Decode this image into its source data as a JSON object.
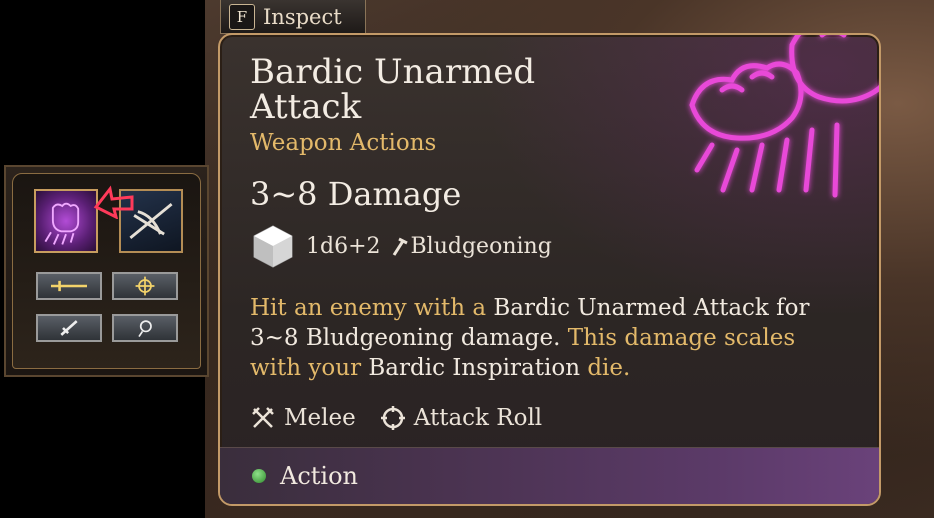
{
  "inspect": {
    "key": "F",
    "label": "Inspect"
  },
  "tooltip": {
    "title": "Bardic Unarmed Attack",
    "subtitle": "Weapon Actions",
    "damage": "3~8 Damage",
    "dice": "1d6+2",
    "damage_type": "Bludgeoning",
    "description": [
      {
        "text": "Hit an enemy with a ",
        "style": "plain"
      },
      {
        "text": "Bardic Unarmed Attack",
        "style": "highlight"
      },
      {
        "text": " for 3~8 Bludgeoning damage. ",
        "style": "highlight"
      },
      {
        "text": "This damage scales with your ",
        "style": "plain"
      },
      {
        "text": "Bardic Inspiration",
        "style": "highlight"
      },
      {
        "text": " die.",
        "style": "plain"
      }
    ],
    "properties": [
      {
        "icon": "crossed-swords-icon",
        "label": "Melee"
      },
      {
        "icon": "crosshair-icon",
        "label": "Attack Roll"
      }
    ],
    "cost": {
      "icon": "action-dot-icon",
      "label": "Action",
      "color": "#4fb84a"
    }
  },
  "hotbar": {
    "slots": [
      {
        "icon": "unarmed-fist-icon",
        "active": true
      },
      {
        "icon": "crossbow-icon",
        "active": false
      }
    ],
    "small_slots": [
      {
        "icon": "sword-icon"
      },
      {
        "icon": "crosshair-icon"
      },
      {
        "icon": "dagger-icon"
      },
      {
        "icon": "hand-icon"
      }
    ]
  },
  "colors": {
    "title": "#f3ece3",
    "accent_gold": "#e3b96a",
    "border": "#c39a68",
    "magic_pink": "#e040d0"
  }
}
